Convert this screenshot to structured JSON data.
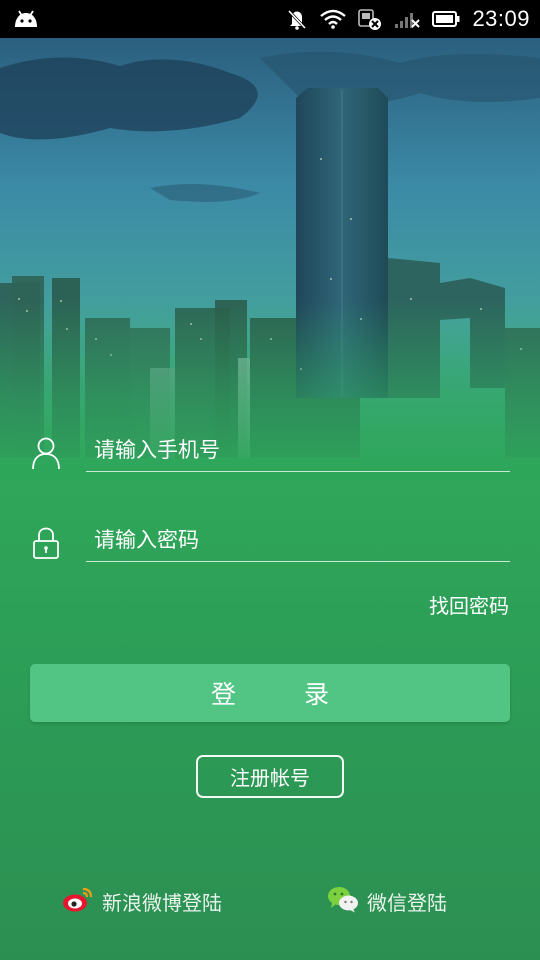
{
  "status_bar": {
    "time": "23:09",
    "icons": [
      "android-icon",
      "mute-icon",
      "wifi-icon",
      "data-off-icon",
      "signal-icon",
      "battery-icon"
    ]
  },
  "login_form": {
    "phone_placeholder": "请输入手机号",
    "phone_icon": "user-icon",
    "password_placeholder": "请输入密码",
    "password_icon": "lock-icon",
    "forgot_password": "找回密码",
    "login_label": "登 录",
    "register_label": "注册帐号"
  },
  "third_party": {
    "weibo_label": "新浪微博登陆",
    "weibo_icon": "weibo-icon",
    "wechat_label": "微信登陆",
    "wechat_icon": "wechat-icon"
  },
  "colors": {
    "primary_green": "#2fa75a",
    "login_button": "#52c585"
  }
}
